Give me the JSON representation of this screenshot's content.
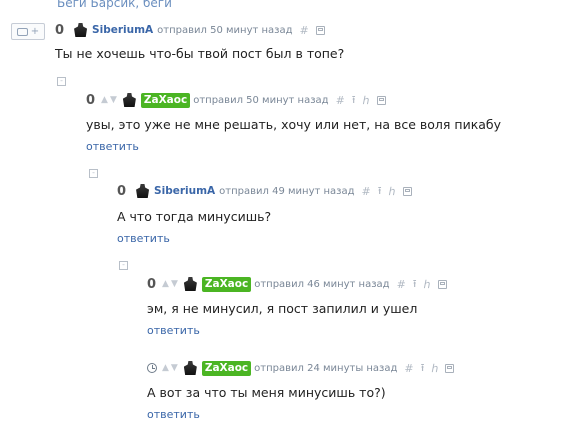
{
  "top": {
    "link_text": "Беги Барсик, беги"
  },
  "reply_widget": {
    "plus": "+"
  },
  "collapse_symbol": "⊟",
  "icons": {
    "hash": "#",
    "up_arrow": "⭱",
    "branch": "ℎ",
    "arrow_up": "▲",
    "arrow_down": "▼"
  },
  "comments": [
    {
      "rating": "0",
      "author": "SiberiumA",
      "action": "отправил 50 минут назад",
      "text": "Ты не хочешь что-бы твой пост был в топе?"
    },
    {
      "rating": "0",
      "author": "ZaXaoc",
      "action": "отправил 50 минут назад",
      "text": "увы, это уже не мне решать, хочу или нет, на все воля пикабу",
      "reply": "ответить"
    },
    {
      "rating": "0",
      "author": "SiberiumA",
      "action": "отправил 49 минут назад",
      "text": "А что тогда минусишь?",
      "reply": "ответить"
    },
    {
      "rating": "0",
      "author": "ZaXaoc",
      "action": "отправил 46 минут назад",
      "text": "эм, я не минусил, я пост запилил и ушел",
      "reply": "ответить"
    },
    {
      "rating": "clock-icon",
      "author": "ZaXaoc",
      "action": "отправил 24 минуты назад",
      "text": "А вот за что ты меня минусишь то?)",
      "reply": "ответить"
    }
  ]
}
